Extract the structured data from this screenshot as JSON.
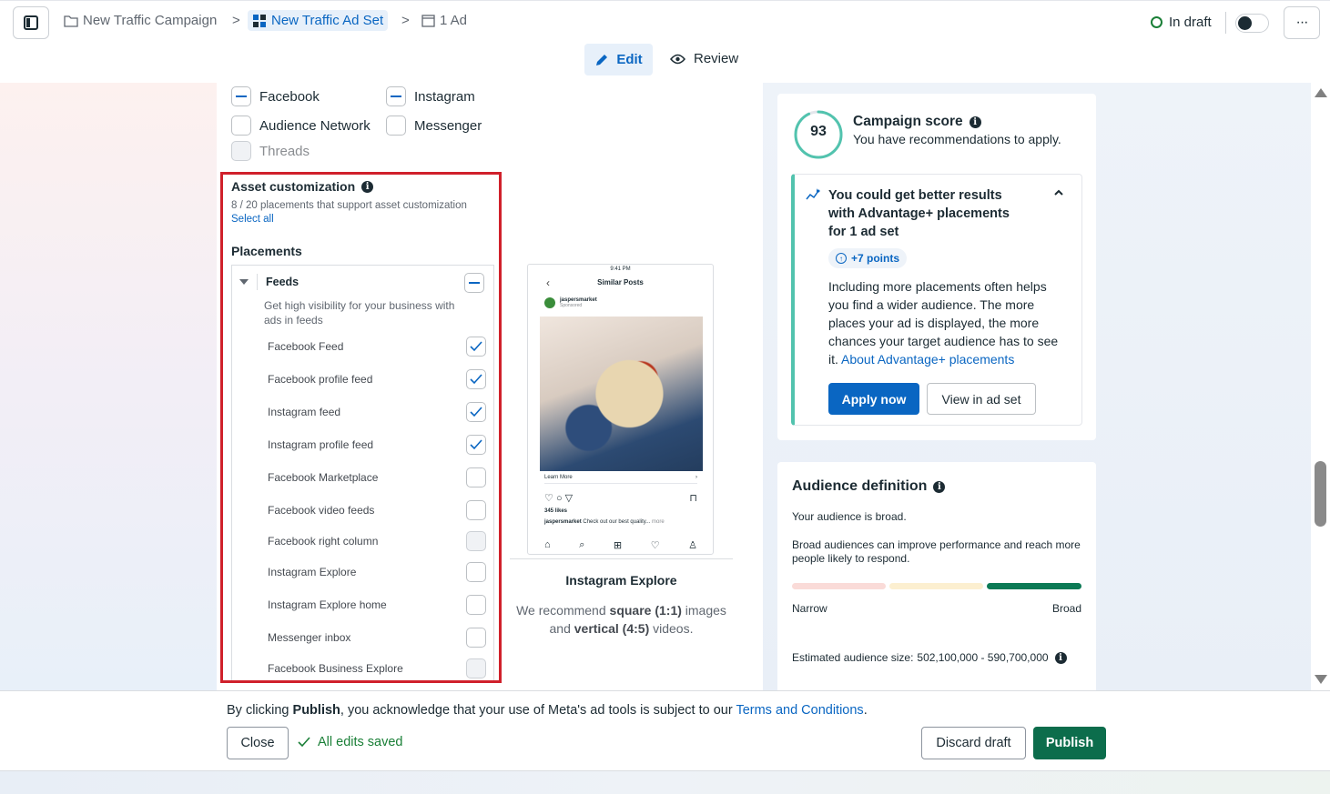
{
  "breadcrumb": {
    "campaign": "New Traffic Campaign",
    "ad_set": "New Traffic Ad Set",
    "ad": "1 Ad",
    "separator": ">"
  },
  "header": {
    "status": "In draft",
    "more": "···"
  },
  "mode_tabs": {
    "edit": "Edit",
    "review": "Review"
  },
  "platforms": [
    {
      "label": "Facebook",
      "state": "indeterminate"
    },
    {
      "label": "Instagram",
      "state": "indeterminate"
    },
    {
      "label": "Audience Network",
      "state": "unchecked"
    },
    {
      "label": "Messenger",
      "state": "unchecked"
    },
    {
      "label": "Threads",
      "state": "disabled"
    }
  ],
  "asset_customization": {
    "title": "Asset customization",
    "subtitle": "8 / 20 placements that support asset customization",
    "select_all": "Select all",
    "placements_title": "Placements",
    "feeds": {
      "title": "Feeds",
      "description": "Get high visibility for your business with ads in feeds",
      "items": [
        {
          "label": "Facebook Feed",
          "state": "checked"
        },
        {
          "label": "Facebook profile feed",
          "state": "checked"
        },
        {
          "label": "Instagram feed",
          "state": "checked"
        },
        {
          "label": "Instagram profile feed",
          "state": "checked"
        },
        {
          "label": "Facebook Marketplace",
          "state": "unchecked"
        },
        {
          "label": "Facebook video feeds",
          "state": "unchecked"
        },
        {
          "label": "Facebook right column",
          "state": "disabled"
        },
        {
          "label": "Instagram Explore",
          "state": "unchecked"
        },
        {
          "label": "Instagram Explore home",
          "state": "unchecked"
        },
        {
          "label": "Messenger inbox",
          "state": "unchecked"
        },
        {
          "label": "Facebook Business Explore",
          "state": "disabled"
        }
      ]
    }
  },
  "preview": {
    "phone_time": "9:41 PM",
    "phone_title": "Similar Posts",
    "account": "jaspersmarket",
    "sponsored": "Sponsored",
    "learn_more": "Learn More",
    "likes": "345 likes",
    "caption_user": "jaspersmarket",
    "caption_text": "Check out our best quality...",
    "caption_more": "more",
    "placement_name": "Instagram Explore",
    "rec_prefix": "We recommend ",
    "rec_square": "square (1:1)",
    "rec_mid": " images and ",
    "rec_vertical": "vertical (4:5)",
    "rec_suffix": " videos."
  },
  "campaign_score": {
    "score": "93",
    "score_fraction": 0.93,
    "title": "Campaign score",
    "subtitle": "You have recommendations to apply.",
    "recommendation": {
      "title": "You could get better results with Advantage+ placements for 1 ad set",
      "points": "+7 points",
      "body": "Including more placements often helps you find a wider audience. The more places your ad is displayed, the more chances your target audience has to see it. ",
      "link": "About Advantage+ placements",
      "apply": "Apply now",
      "view": "View in ad set"
    }
  },
  "audience": {
    "title": "Audience definition",
    "broadness": "Your audience is broad.",
    "description": "Broad audiences can improve performance and reach more people likely to respond.",
    "narrow_label": "Narrow",
    "broad_label": "Broad",
    "estimated_label": "Estimated audience size: ",
    "estimated_value": "502,100,000 - 590,700,000"
  },
  "footer": {
    "legal_prefix": "By clicking ",
    "legal_bold": "Publish",
    "legal_mid": ", you acknowledge that your use of Meta's ad tools is subject to our ",
    "legal_link": "Terms and Conditions",
    "legal_suffix": ".",
    "close": "Close",
    "saved": "All edits saved",
    "discard": "Discard draft",
    "publish": "Publish"
  },
  "colors": {
    "accent_blue": "#0a66c2",
    "publish_green": "#0c6d4c",
    "highlight_red": "#d0202b",
    "score_ring": "#52c3ae",
    "meter_narrow": "#fadbd8",
    "meter_mid": "#fcefd0",
    "meter_broad": "#0c7a55"
  }
}
